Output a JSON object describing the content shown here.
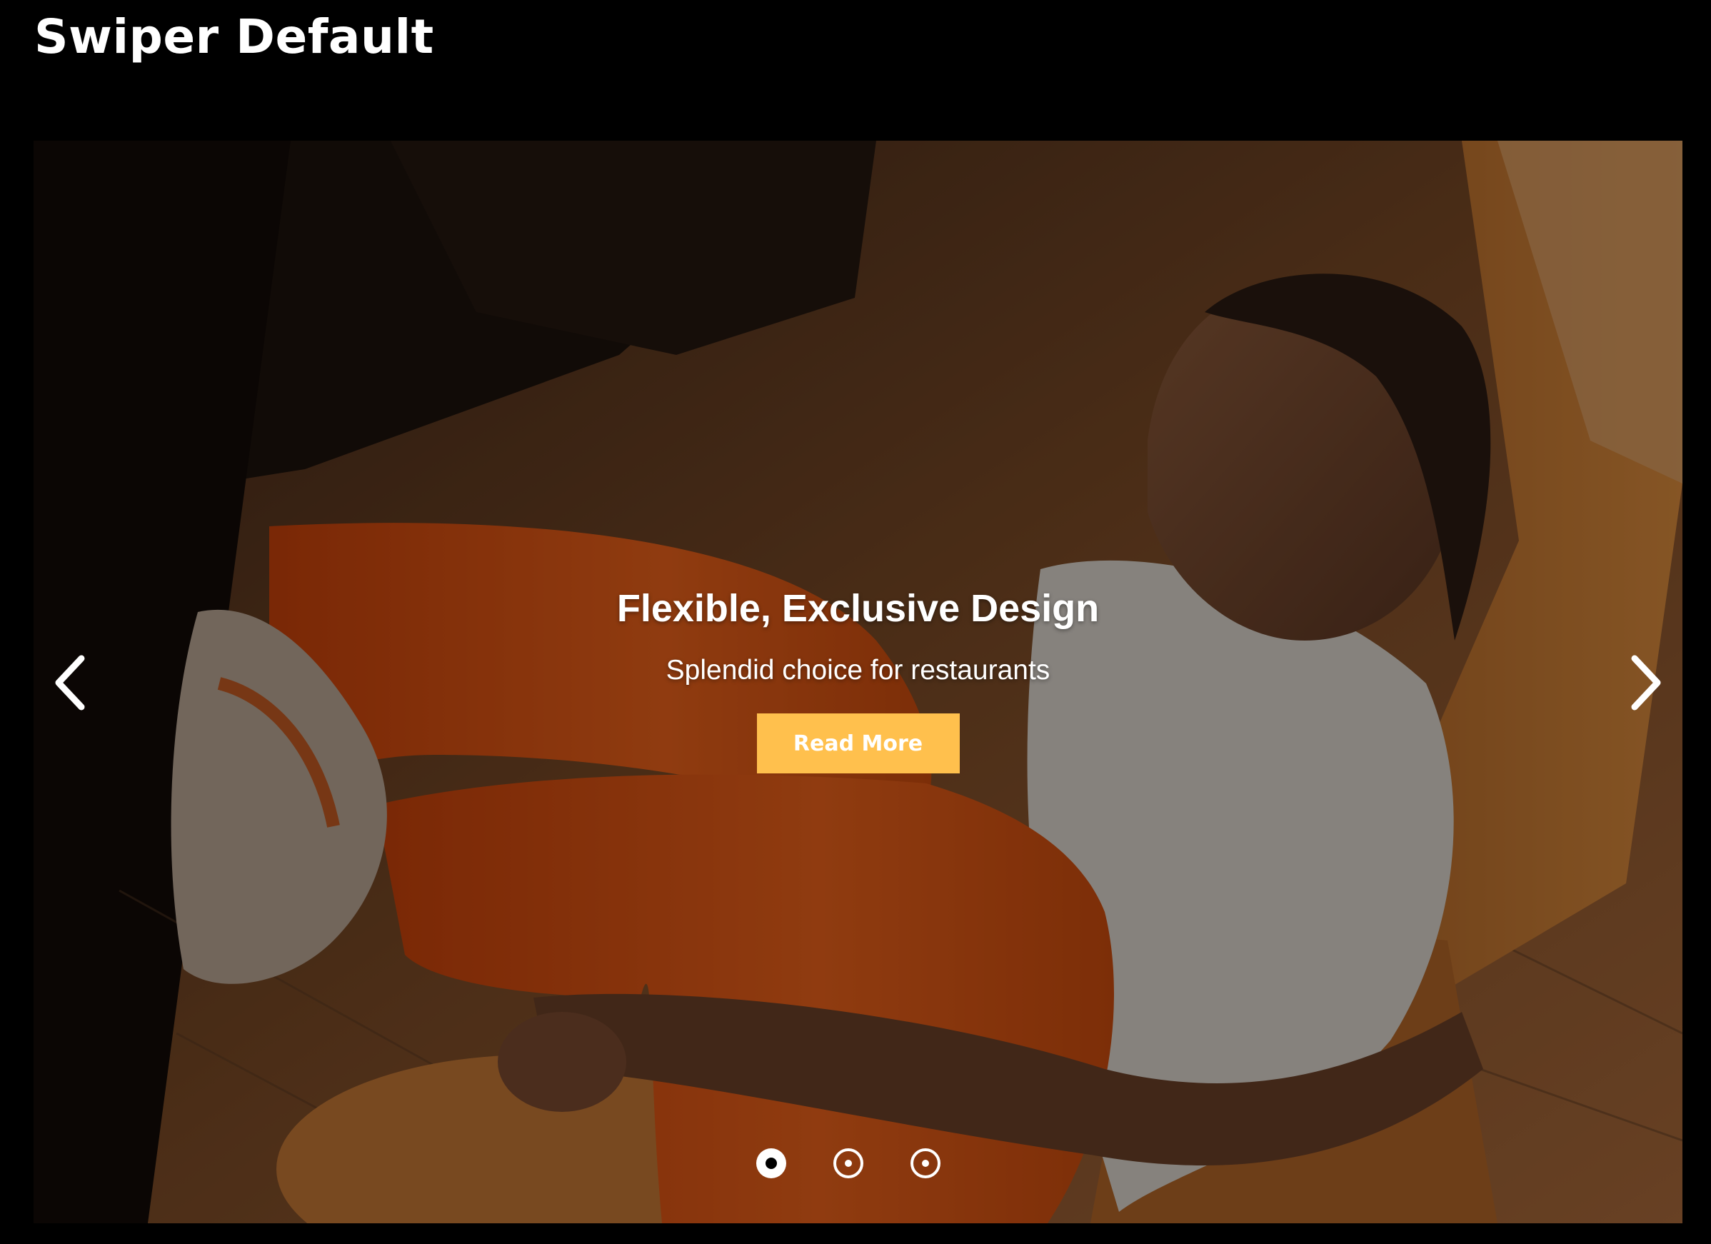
{
  "page": {
    "title": "Swiper Default"
  },
  "slider": {
    "active_index": 0,
    "slides": [
      {
        "title": "Flexible, Exclusive Design",
        "subtitle": "Splendid choice for restaurants",
        "button_label": "Read More"
      }
    ],
    "prev_icon": "chevron-left-icon",
    "next_icon": "chevron-right-icon",
    "bullet_count": 3
  },
  "colors": {
    "background": "#000000",
    "accent_button": "#ffc04d",
    "text": "#ffffff",
    "legging_orange": "#e2560f"
  }
}
